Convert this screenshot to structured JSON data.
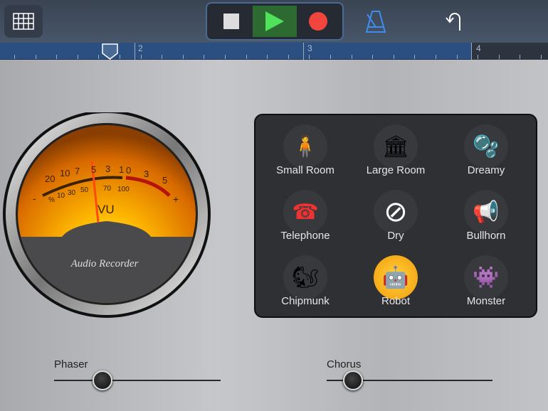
{
  "toolbar": {
    "icons": [
      "grid-icon",
      "stop-icon",
      "play-icon",
      "record-icon",
      "metronome-icon",
      "undo-icon"
    ]
  },
  "ruler": {
    "markers": [
      "2",
      "3",
      "4"
    ]
  },
  "vu_meter": {
    "upper_scale": [
      "20",
      "10",
      "7",
      "5",
      "3",
      "1",
      "0",
      "3",
      "5"
    ],
    "lower_scale": [
      "%",
      "10",
      "30",
      "50",
      "70",
      "100"
    ],
    "minus": "-",
    "plus": "+",
    "label": "VU",
    "brand": "Audio Recorder"
  },
  "effects": [
    {
      "label": "Small Room",
      "icon": "🧍"
    },
    {
      "label": "Large Room",
      "icon": "🏛"
    },
    {
      "label": "Dreamy",
      "icon": "🫧"
    },
    {
      "label": "Telephone",
      "icon": "☎"
    },
    {
      "label": "Dry",
      "icon": "⊘"
    },
    {
      "label": "Bullhorn",
      "icon": "📢"
    },
    {
      "label": "Chipmunk",
      "icon": "🐿"
    },
    {
      "label": "Robot",
      "icon": "🤖"
    },
    {
      "label": "Monster",
      "icon": "👾"
    }
  ],
  "selected_effect": "Robot",
  "sliders": [
    {
      "label": "Phaser",
      "value": 0.29
    },
    {
      "label": "Chorus",
      "value": 0.16
    }
  ]
}
